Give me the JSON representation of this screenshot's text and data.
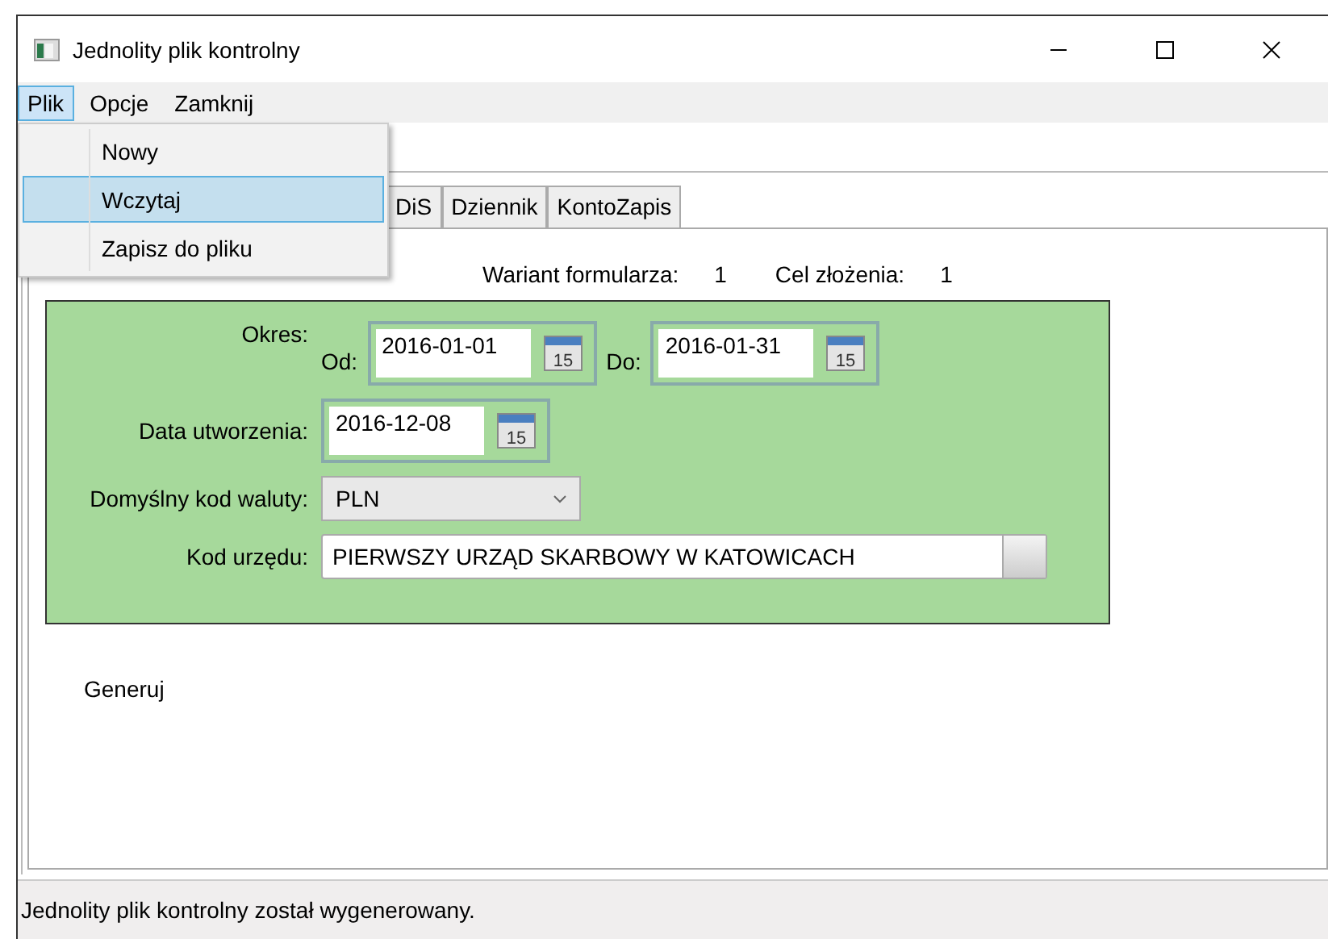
{
  "window": {
    "title": "Jednolity plik kontrolny"
  },
  "menu_bar": [
    {
      "label": "Plik",
      "selected": true
    },
    {
      "label": "Opcje",
      "selected": false
    },
    {
      "label": "Zamknij",
      "selected": false
    }
  ],
  "menu_dropdown": [
    {
      "label": "Nowy",
      "selected": false
    },
    {
      "label": "Wczytaj",
      "selected": true
    },
    {
      "label": "Zapisz do pliku",
      "selected": false
    }
  ],
  "tabs": [
    {
      "label": "DiS"
    },
    {
      "label": "Dziennik"
    },
    {
      "label": "KontoZapis"
    }
  ],
  "info": [
    {
      "label": "Wariant formularza:",
      "value": "1"
    },
    {
      "label": "Cel złożenia:",
      "value": "1"
    }
  ],
  "form": {
    "period_label": "Okres:",
    "from_label": "Od:",
    "from_date": "2016-01-01",
    "to_label": "Do:",
    "to_date": "2016-01-31",
    "created_label": "Data utworzenia:",
    "created_date": "2016-12-08",
    "from_calendar_text": "15",
    "to_calendar_text": "15",
    "created_calendar_text": "15",
    "currency_label": "Domyślny kod waluty:",
    "currency": "PLN",
    "office_label": "Kod urzędu:",
    "office": "PIERWSZY URZĄD SKARBOWY W KATOWICACH"
  },
  "generate_button": "Generuj",
  "status_bar": "Jednolity plik kontrolny został wygenerowany."
}
